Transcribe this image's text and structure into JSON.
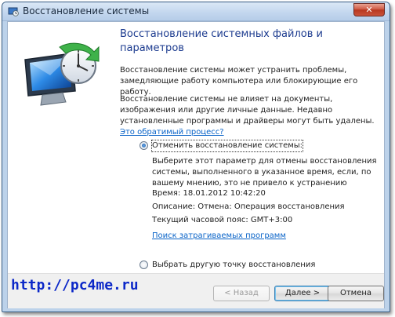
{
  "window": {
    "title": "Восстановление системы",
    "close_label": "✕"
  },
  "page": {
    "title": "Восстановление системных файлов и параметров",
    "intro": "Восстановление системы может устранить проблемы, замедляющие работу компьютера или блокирующие его работу.",
    "note": "Восстановление системы не влияет на документы, изображения или другие личные данные. Недавно установленные программы и драйверы могут быть удалены.",
    "note_link": "Это обратимый процесс?"
  },
  "options": {
    "undo": {
      "label": "Отменить восстановление системы:",
      "checked": true,
      "description": "Выберите этот параметр для отмены восстановления системы, выполненного в указанное время, если, по вашему мнению, это не привело к устранению",
      "time": "Время: 18.01.2012 10:42:20",
      "desc_line": "Описание: Отмена: Операция восстановления",
      "timezone": "Текущий часовой пояс: GMT+3:00",
      "affected_link": "Поиск затрагиваемых программ"
    },
    "other": {
      "label": "Выбрать другую точку восстановления",
      "checked": false
    }
  },
  "footer": {
    "watermark": "http://pc4me.ru",
    "back": "< Назад",
    "next": "Далее >",
    "cancel": "Отмена"
  }
}
